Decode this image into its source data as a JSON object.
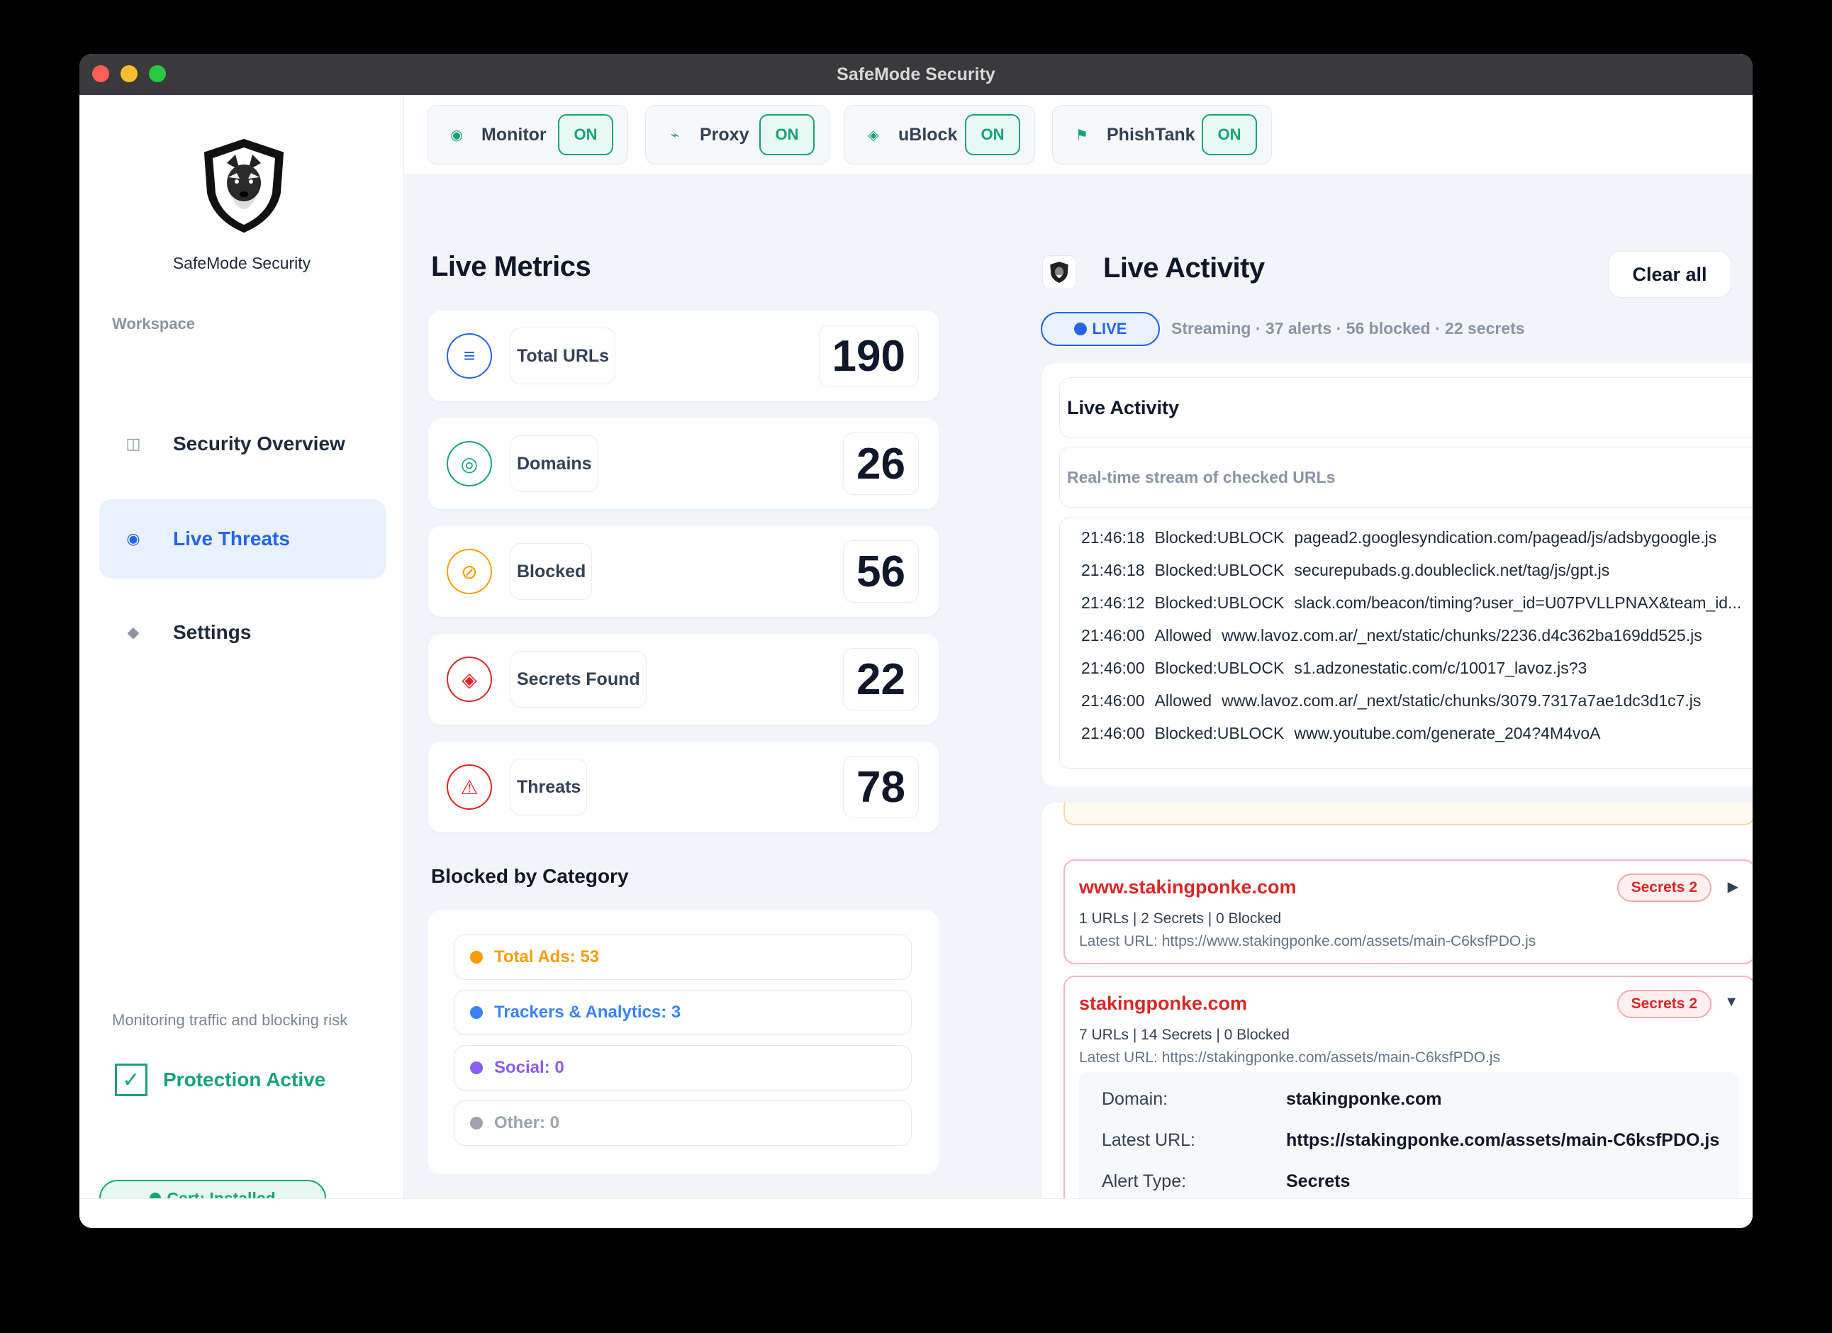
{
  "window": {
    "title": "SafeMode Security"
  },
  "sidebar": {
    "brand": "SafeMode Security",
    "section_label": "Workspace",
    "items": [
      {
        "label": "Security Overview",
        "icon": "columns-icon"
      },
      {
        "label": "Live Threats",
        "icon": "radio-dot-icon",
        "active": true
      },
      {
        "label": "Settings",
        "icon": "diamond-icon"
      }
    ],
    "status_message": "Monitoring traffic and blocking risk",
    "protection_label": "Protection Active",
    "cert_label": "Cert: Installed"
  },
  "toggles": [
    {
      "label": "Monitor",
      "state": "ON",
      "icon": "target-icon"
    },
    {
      "label": "Proxy",
      "state": "ON",
      "icon": "proxy-icon"
    },
    {
      "label": "uBlock",
      "state": "ON",
      "icon": "diamond-icon"
    },
    {
      "label": "PhishTank",
      "state": "ON",
      "icon": "flag-icon"
    }
  ],
  "metrics": {
    "title": "Live Metrics",
    "items": [
      {
        "label": "Total URLs",
        "value": "190",
        "color": "#2563eb",
        "icon": "list-icon"
      },
      {
        "label": "Domains",
        "value": "26",
        "color": "#16a37a",
        "icon": "target-icon"
      },
      {
        "label": "Blocked",
        "value": "56",
        "color": "#f59e0b",
        "icon": "block-icon"
      },
      {
        "label": "Secrets Found",
        "value": "22",
        "color": "#dc2626",
        "icon": "secret-icon"
      },
      {
        "label": "Threats",
        "value": "78",
        "color": "#dc2626",
        "icon": "warning-icon"
      }
    ]
  },
  "categories": {
    "title": "Blocked by Category",
    "items": [
      {
        "label": "Total Ads: 53",
        "color": "#f59e0b"
      },
      {
        "label": "Trackers & Analytics: 3",
        "color": "#3b82f6"
      },
      {
        "label": "Social: 0",
        "color": "#8b5cf6"
      },
      {
        "label": "Other: 0",
        "color": "#9ca3af"
      }
    ]
  },
  "activity": {
    "title": "Live Activity",
    "clear_label": "Clear all",
    "live_label": "LIVE",
    "stream_status": "Streaming · 37 alerts · 56 blocked · 22 secrets",
    "card_title": "Live Activity",
    "card_subtitle": "Real-time stream of checked URLs",
    "log": [
      {
        "time": "21:46:18",
        "status": "Blocked:UBLOCK",
        "url": "pagead2.googlesyndication.com/pagead/js/adsbygoogle.js"
      },
      {
        "time": "21:46:18",
        "status": "Blocked:UBLOCK",
        "url": "securepubads.g.doubleclick.net/tag/js/gpt.js"
      },
      {
        "time": "21:46:12",
        "status": "Blocked:UBLOCK",
        "url": "slack.com/beacon/timing?user_id=U07PVLLPNAX&team_id..."
      },
      {
        "time": "21:46:00",
        "status": "Allowed",
        "url": "www.lavoz.com.ar/_next/static/chunks/2236.d4c362ba169dd525.js"
      },
      {
        "time": "21:46:00",
        "status": "Blocked:UBLOCK",
        "url": "s1.adzonestatic.com/c/10017_lavoz.js?3"
      },
      {
        "time": "21:46:00",
        "status": "Allowed",
        "url": "www.lavoz.com.ar/_next/static/chunks/3079.7317a7ae1dc3d1c7.js"
      },
      {
        "time": "21:46:00",
        "status": "Blocked:UBLOCK",
        "url": "www.youtube.com/generate_204?4M4voA"
      }
    ]
  },
  "domains": [
    {
      "name": "www.stakingponke.com",
      "stats": "1 URLs | 2 Secrets | 0 Blocked",
      "latest": "Latest URL: https://www.stakingponke.com/assets/main-C6ksfPDO.js",
      "badge": "Secrets 2",
      "caret": "▶"
    },
    {
      "name": "stakingponke.com",
      "stats": "7 URLs | 14 Secrets | 0 Blocked",
      "latest": "Latest URL: https://stakingponke.com/assets/main-C6ksfPDO.js",
      "badge": "Secrets 2",
      "caret": "▼",
      "details": [
        {
          "key": "Domain:",
          "value": "stakingponke.com"
        },
        {
          "key": "Latest URL:",
          "value": "https://stakingponke.com/assets/main-C6ksfPDO.js"
        },
        {
          "key": "Alert Type:",
          "value": "Secrets"
        }
      ]
    }
  ]
}
